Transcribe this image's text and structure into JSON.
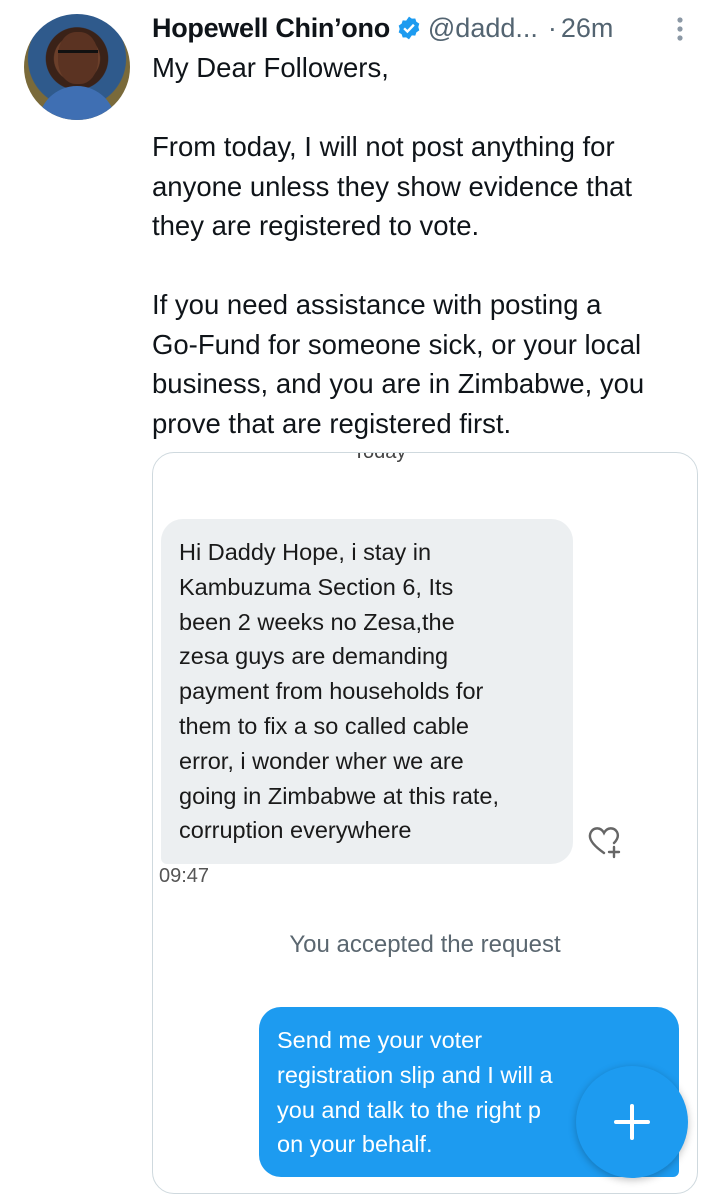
{
  "tweet": {
    "author_name": "Hopewell Chin’ono",
    "handle": "@dadd...",
    "separator": "·",
    "time": "26m",
    "lines": [
      "My Dear Followers,",
      "",
      "From today, I will not post anything for",
      "anyone unless they show evidence that",
      "they are registered to vote.",
      "",
      "If you need assistance with posting a",
      "Go-Fund for someone sick, or your local",
      "business, and you are in Zimbabwe, you",
      "prove that are registered first."
    ]
  },
  "media": {
    "cut_header": "Today",
    "incoming_message_lines": [
      "Hi Daddy Hope, i stay in",
      "Kambuzuma Section 6, Its",
      "been 2 weeks no Zesa,the",
      "zesa guys are demanding",
      "payment from households for",
      "them to fix a so called cable",
      "error, i wonder wher we are",
      "going in Zimbabwe at this rate,",
      "corruption everywhere"
    ],
    "incoming_time": "09:47",
    "system_notice": "You accepted the request",
    "outgoing_message_lines": [
      "Send me your voter",
      "registration slip and I will a",
      "you and talk to the right p",
      "on your behalf."
    ]
  },
  "colors": {
    "accent": "#1d9bf0",
    "secondary_text": "#536471",
    "incoming_bubble": "#eceff1"
  },
  "icons": {
    "verified": "verified-badge-icon",
    "more": "more-vertical-icon",
    "react": "heart-plus-icon",
    "compose": "plus-icon"
  }
}
